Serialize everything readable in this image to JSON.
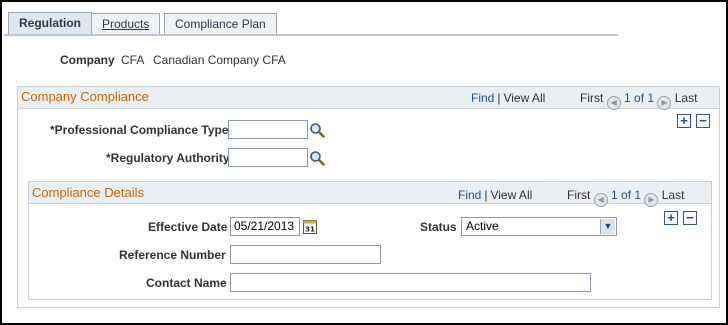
{
  "tabs": [
    {
      "label": "Regulation",
      "active": true
    },
    {
      "label": "Products",
      "active": false
    },
    {
      "label": "Compliance Plan",
      "active": false
    }
  ],
  "company": {
    "label": "Company",
    "code": "CFA",
    "name": "Canadian Company CFA"
  },
  "company_compliance": {
    "title": "Company Compliance",
    "nav": {
      "find": "Find",
      "view_all": "View All",
      "first": "First",
      "range": "1 of 1",
      "last": "Last"
    },
    "fields": {
      "professional_compliance_type": {
        "label": "*Professional Compliance Type",
        "value": ""
      },
      "regulatory_authority": {
        "label": "*Regulatory Authority",
        "value": ""
      }
    },
    "add": "+",
    "remove": "−"
  },
  "compliance_details": {
    "title": "Compliance Details",
    "nav": {
      "find": "Find",
      "view_all": "View All",
      "first": "First",
      "range": "1 of 1",
      "last": "Last"
    },
    "fields": {
      "effective_date": {
        "label": "Effective Date",
        "value": "05/21/2013"
      },
      "status": {
        "label": "Status",
        "value": "Active"
      },
      "reference_number": {
        "label": "Reference Number",
        "value": ""
      },
      "contact_name": {
        "label": "Contact Name",
        "value": ""
      }
    },
    "add": "+",
    "remove": "−"
  },
  "colors": {
    "section_title": "#cc6600",
    "link": "#1d4fa3",
    "header_bg": "#ebeef2"
  }
}
